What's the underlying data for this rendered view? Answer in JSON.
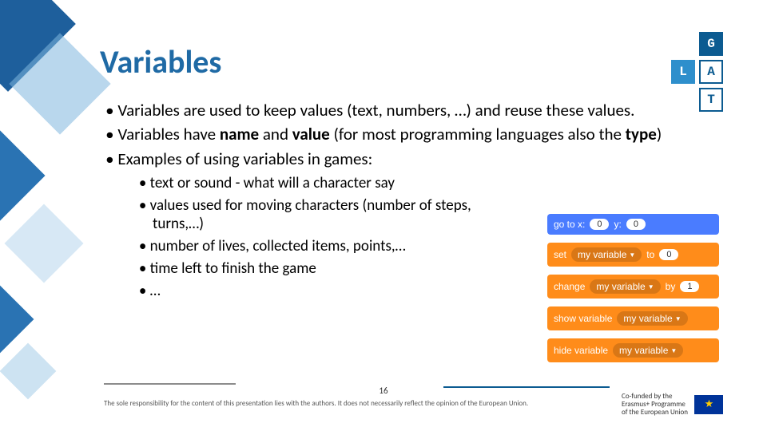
{
  "title": "Variables",
  "logo": {
    "g": "G",
    "l": "L",
    "a": "A",
    "t": "T"
  },
  "bullets": {
    "b1a": "Variables are used to keep values (text, numbers, …) and reuse these values.",
    "b2_pre": "Variables have ",
    "b2_name": "name",
    "b2_mid": " and ",
    "b2_value": "value",
    "b2_post1": " (for most programming languages also the ",
    "b2_type": "type",
    "b2_post2": ")",
    "b3": "Examples of using variables in games:"
  },
  "sub": {
    "s1": "text or sound - what will a character say",
    "s2": "values used for moving characters (number of steps, turns,…)",
    "s3": "number of lives, collected items, points,…",
    "s4": "time left to finish the game",
    "s5": "…"
  },
  "blocks": {
    "goto_label": "go to x:",
    "goto_x": "0",
    "goto_y_label": "y:",
    "goto_y": "0",
    "set_label": "set",
    "myvar": "my variable",
    "to_label": "to",
    "set_val": "0",
    "change_label": "change",
    "by_label": "by",
    "change_val": "1",
    "show_label": "show variable",
    "hide_label": "hide variable"
  },
  "page_number": "16",
  "disclaimer": "The sole responsibility for the content of this presentation lies with the authors. It does not necessarily reflect the opinion of the European Union.",
  "eu": {
    "line1": "Co-funded by the",
    "line2": "Erasmus+ Programme",
    "line3": "of the European Union"
  }
}
